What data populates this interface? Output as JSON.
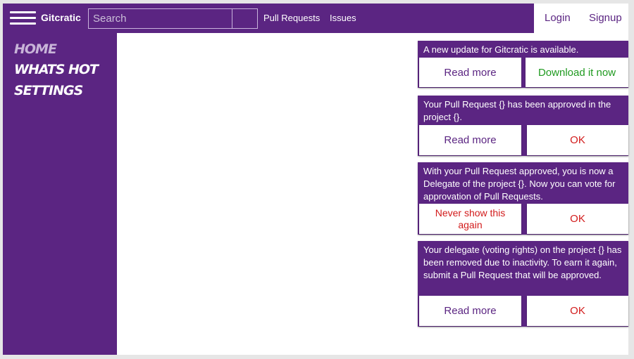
{
  "app": {
    "brand": "Gitcratic"
  },
  "topbar": {
    "search_placeholder": "Search",
    "nav": [
      "Pull Requests",
      "Issues"
    ],
    "login": "Login",
    "signup": "Signup"
  },
  "sidebar": {
    "items": [
      {
        "label": "Home"
      },
      {
        "label": "Whats hot"
      },
      {
        "label": "Settings"
      }
    ]
  },
  "notifications": [
    {
      "message": "A new update for Gitcratic is available.",
      "primary": "Read more",
      "secondary": "Download it now"
    },
    {
      "message": "Your Pull Request {} has been approved in the project {}.",
      "primary": "Read more",
      "secondary": "OK"
    },
    {
      "message": "With your Pull Request approved, you is now a Delegate of the project {}. Now you can vote for approvation of Pull Requests.",
      "primary": "Never show this again",
      "secondary": "OK"
    },
    {
      "message": "Your delegate (voting rights) on the project {} has been removed due to inactivity. To earn it again, submit a Pull Request that will be approved.",
      "primary": "Read more",
      "secondary": "OK"
    }
  ],
  "colors": {
    "brand": "#5b2582",
    "accept": "#1f9a1f",
    "danger": "#d21b1b"
  }
}
